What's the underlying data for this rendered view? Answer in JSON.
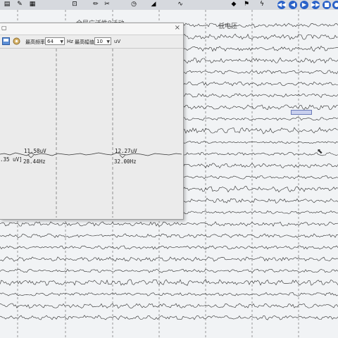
{
  "app": {
    "top_label_left": "全局广泛性θ活动",
    "top_label_right": "低电压"
  },
  "toolbar": {
    "icons": [
      "page-icon",
      "tool-icon",
      "grid-icon",
      "mark-icon",
      "pen-icon",
      "scissors-icon",
      "clock-icon",
      "ruler-icon",
      "wave-icon",
      "palette-icon",
      "flag-icon",
      "lightning-icon"
    ],
    "nav_buttons": [
      "◀◀",
      "◀",
      "▶",
      "▶▶",
      "■",
      "●"
    ]
  },
  "spectrum_window": {
    "max_freq_label": "最高频率",
    "max_freq_value": "64",
    "max_freq_unit": "Hz",
    "max_amp_label": "最高幅值",
    "max_amp_value": "10",
    "max_amp_unit": "uV",
    "peaks": [
      {
        "amp": "11.58uV",
        "freq": "28.44Hz"
      },
      {
        "amp": "12.27uV",
        "freq": "32.00Hz"
      }
    ],
    "left_clip_label": ".35 uV]"
  },
  "colors": {
    "trace": "#2b2b2b",
    "grid_dash": "#6f6f6f",
    "marker": "#c9d0ee"
  }
}
